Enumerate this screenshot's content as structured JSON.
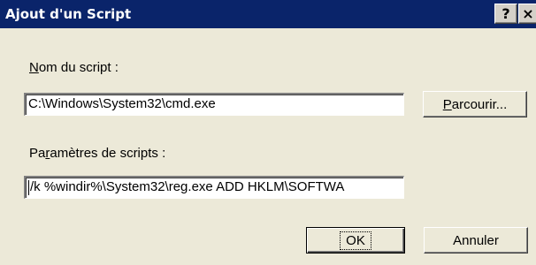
{
  "window": {
    "title": "Ajout d'un Script",
    "help_label": "?",
    "close_label": "×"
  },
  "form": {
    "script_name": {
      "label_accel": "N",
      "label_rest": "om du script :",
      "value": "C:\\Windows\\System32\\cmd.exe"
    },
    "browse_button": {
      "label_accel": "P",
      "label_rest": "arcourir..."
    },
    "script_params": {
      "label_pre": "Pa",
      "label_accel": "r",
      "label_rest": "amètres de scripts :",
      "value": "/k %windir%\\System32\\reg.exe ADD HKLM\\SOFTWA"
    }
  },
  "buttons": {
    "ok": "OK",
    "cancel": "Annuler"
  }
}
